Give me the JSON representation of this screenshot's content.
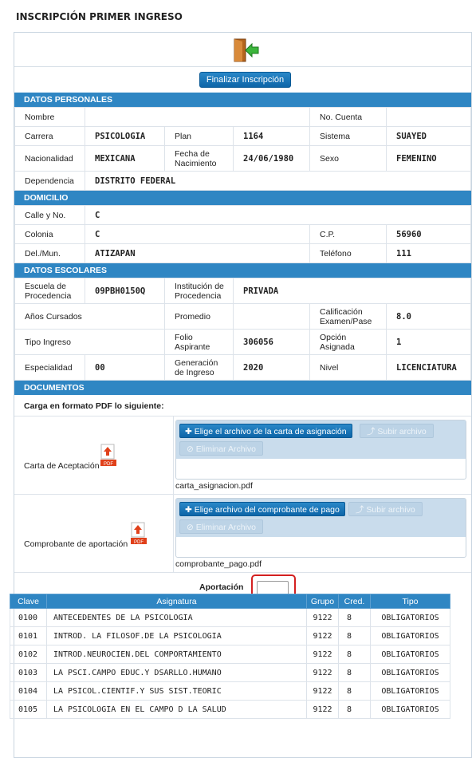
{
  "page_title": "INSCRIPCIÓN PRIMER INGRESO",
  "finalizar_label": "Finalizar Inscripción",
  "sections": {
    "personal": "DATOS PERSONALES",
    "domicilio": "DOMICILIO",
    "escolares": "DATOS ESCOLARES",
    "documentos": "DOCUMENTOS"
  },
  "personal": {
    "nombre_label": "Nombre",
    "nombre": "",
    "cuenta_label": "No. Cuenta",
    "cuenta": "",
    "carrera_label": "Carrera",
    "carrera": "PSICOLOGIA",
    "plan_label": "Plan",
    "plan": "1164",
    "sistema_label": "Sistema",
    "sistema": "SUAYED",
    "nacionalidad_label": "Nacionalidad",
    "nacionalidad": "MEXICANA",
    "fecha_label": "Fecha de Nacimiento",
    "fecha": "24/06/1980",
    "sexo_label": "Sexo",
    "sexo": "FEMENINO",
    "dependencia_label": "Dependencia",
    "dependencia": "DISTRITO FEDERAL"
  },
  "domicilio": {
    "calle_label": "Calle y No.",
    "calle": "C",
    "colonia_label": "Colonia",
    "colonia": "C",
    "cp_label": "C.P.",
    "cp": "56960",
    "delmun_label": "Del./Mun.",
    "delmun": "ATIZAPAN",
    "telefono_label": "Teléfono",
    "telefono": "111"
  },
  "escolares": {
    "escuela_label": "Escuela de Procedencia",
    "escuela": "09PBH0150Q",
    "institucion_label": "Institución de Procedencia",
    "institucion": "PRIVADA",
    "anios_label": "Años Cursados",
    "anios": "",
    "promedio_label": "Promedio",
    "promedio": "",
    "calif_label": "Calificación Examen/Pase",
    "calif": "8.0",
    "tipo_label": "Tipo Ingreso",
    "tipo": "",
    "folio_label": "Folio Aspirante",
    "folio": "306056",
    "opcion_label": "Opción Asignada",
    "opcion": "1",
    "especialidad_label": "Especialidad",
    "especialidad": "00",
    "generacion_label": "Generación de Ingreso",
    "generacion": "2020",
    "nivel_label": "Nivel",
    "nivel": "LICENCIATURA"
  },
  "documentos": {
    "instruccion": "Carga en formato PDF lo siguiente:",
    "doc1_label": "Carta de Aceptación",
    "doc1_choose": "✚ Elige el archivo de la carta de asignación",
    "doc1_file": "carta_asignacion.pdf",
    "doc2_label": "Comprobante de aportación",
    "doc2_choose": "✚ Elige archivo del comprobante de pago",
    "doc2_file": "comprobante_pago.pdf",
    "subir_label": "⤴ Subir archivo",
    "eliminar_label": "⊘ Eliminar Archivo",
    "pdf_badge": "PDF",
    "aportacion_label": "Aportación"
  },
  "materias": {
    "headers": [
      "Clave",
      "Asignatura",
      "Grupo",
      "Cred.",
      "Tipo"
    ],
    "rows": [
      [
        "0100",
        "ANTECEDENTES DE LA PSICOLOGIA",
        "9122",
        "8",
        "OBLIGATORIOS"
      ],
      [
        "0101",
        "INTROD. LA FILOSOF.DE LA PSICOLOGIA",
        "9122",
        "8",
        "OBLIGATORIOS"
      ],
      [
        "0102",
        "INTROD.NEUROCIEN.DEL COMPORTAMIENTO",
        "9122",
        "8",
        "OBLIGATORIOS"
      ],
      [
        "0103",
        "LA PSCI.CAMPO EDUC.Y DSARLLO.HUMANO",
        "9122",
        "8",
        "OBLIGATORIOS"
      ],
      [
        "0104",
        "LA PSICOL.CIENTIF.Y SUS SIST.TEORIC",
        "9122",
        "8",
        "OBLIGATORIOS"
      ],
      [
        "0105",
        "LA PSICOLOGIA EN EL CAMPO D LA SALUD",
        "9122",
        "8",
        "OBLIGATORIOS"
      ]
    ]
  },
  "colors": {
    "accent": "#2f86c3",
    "highlight": "#d42020"
  }
}
